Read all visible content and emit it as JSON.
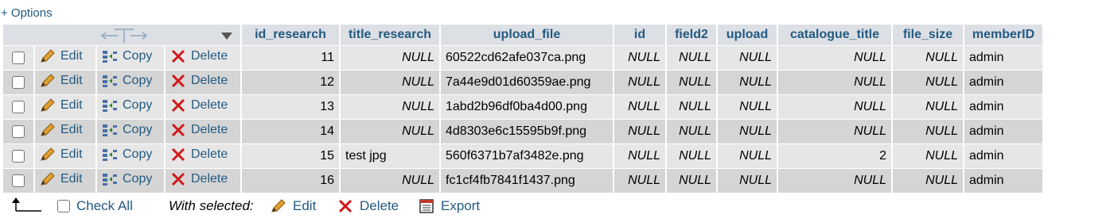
{
  "options_link": "+ Options",
  "columns": [
    "id_research",
    "title_research",
    "upload_file",
    "id",
    "field2",
    "upload",
    "catalogue_title",
    "file_size",
    "memberID"
  ],
  "actions": {
    "edit": "Edit",
    "copy": "Copy",
    "delete": "Delete"
  },
  "rows": [
    {
      "id_research": "11",
      "title_research": "NULL",
      "upload_file": "60522cd62afe037ca.png",
      "id": "NULL",
      "field2": "NULL",
      "upload": "NULL",
      "catalogue_title": "NULL",
      "file_size": "NULL",
      "memberID": "admin"
    },
    {
      "id_research": "12",
      "title_research": "NULL",
      "upload_file": "7a44e9d01d60359ae.png",
      "id": "NULL",
      "field2": "NULL",
      "upload": "NULL",
      "catalogue_title": "NULL",
      "file_size": "NULL",
      "memberID": "admin"
    },
    {
      "id_research": "13",
      "title_research": "NULL",
      "upload_file": "1abd2b96df0ba4d00.png",
      "id": "NULL",
      "field2": "NULL",
      "upload": "NULL",
      "catalogue_title": "NULL",
      "file_size": "NULL",
      "memberID": "admin"
    },
    {
      "id_research": "14",
      "title_research": "NULL",
      "upload_file": "4d8303e6c15595b9f.png",
      "id": "NULL",
      "field2": "NULL",
      "upload": "NULL",
      "catalogue_title": "NULL",
      "file_size": "NULL",
      "memberID": "admin"
    },
    {
      "id_research": "15",
      "title_research": "test jpg",
      "upload_file": "560f6371b7af3482e.png",
      "id": "NULL",
      "field2": "NULL",
      "upload": "NULL",
      "catalogue_title": "2",
      "file_size": "NULL",
      "memberID": "admin"
    },
    {
      "id_research": "16",
      "title_research": "NULL",
      "upload_file": "fc1cf4fb7841f1437.png",
      "id": "NULL",
      "field2": "NULL",
      "upload": "NULL",
      "catalogue_title": "NULL",
      "file_size": "NULL",
      "memberID": "admin"
    }
  ],
  "footer": {
    "check_all": "Check All",
    "with_selected": "With selected:",
    "edit": "Edit",
    "delete": "Delete",
    "export": "Export"
  },
  "colors": {
    "link": "#235a81",
    "header_bg": "#dcdfe4",
    "row_odd": "#e6e6e6",
    "row_even": "#d5d5d5",
    "delete_x": "#d0191a",
    "edit_pencil": "#e0a030"
  },
  "icons": [
    "sort-arrows-icon",
    "dropdown-arrow-icon",
    "pencil-icon",
    "copy-icon",
    "delete-x-icon",
    "select-arrow-icon",
    "export-icon"
  ]
}
